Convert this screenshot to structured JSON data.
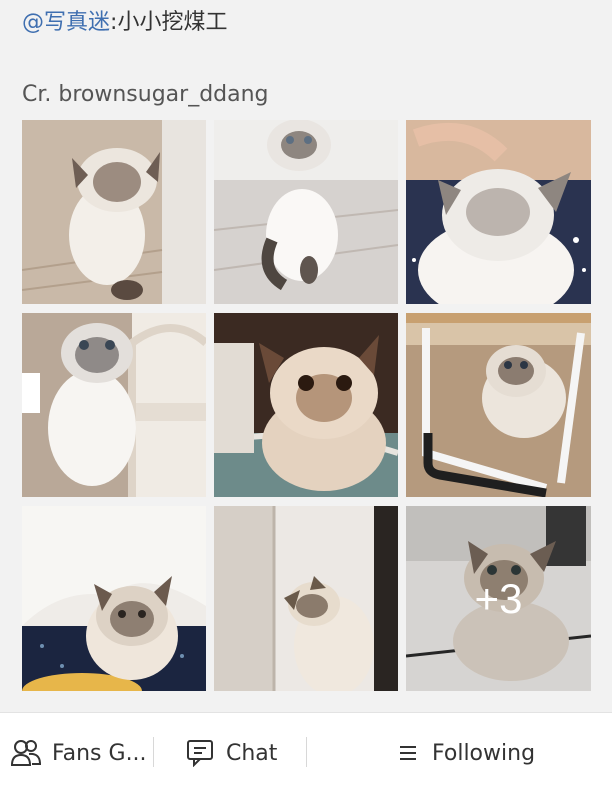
{
  "post": {
    "mention": "@写真迷",
    "separator": ":",
    "author": "小小挖煤工",
    "credit": "Cr. brownsugar_ddang"
  },
  "gallery": {
    "photo_subject_icon": "cat-photo",
    "more_count": "+3"
  },
  "bottom_bar": {
    "fans_label": "Fans G...",
    "fans_icon": "people-icon",
    "chat_label": "Chat",
    "chat_icon": "chat-bubble-icon",
    "following_label": "Following",
    "following_icon": "menu-lines-icon"
  }
}
